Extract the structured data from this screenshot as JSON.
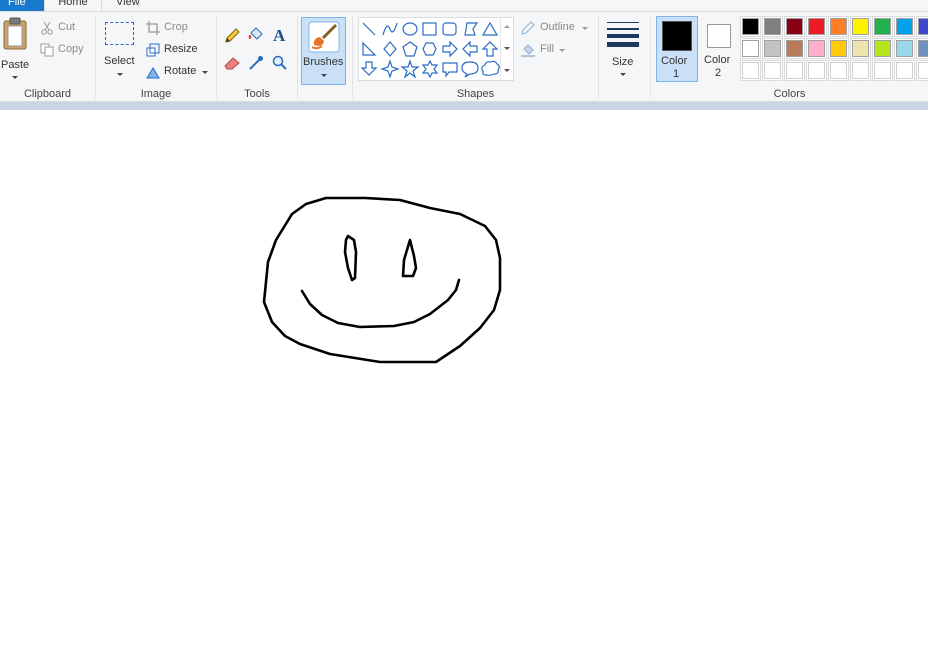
{
  "tabs": {
    "file": "File",
    "home": "Home",
    "view": "View"
  },
  "clipboard": {
    "paste": "Paste",
    "cut": "Cut",
    "copy": "Copy",
    "group": "Clipboard"
  },
  "image": {
    "select": "Select",
    "crop": "Crop",
    "resize": "Resize",
    "rotate": "Rotate",
    "group": "Image"
  },
  "tools": {
    "group": "Tools"
  },
  "brushes": {
    "label": "Brushes"
  },
  "shapes": {
    "outline": "Outline",
    "fill": "Fill",
    "group": "Shapes"
  },
  "size": {
    "label": "Size"
  },
  "colors": {
    "color1_line1": "Color",
    "color1_line2": "1",
    "color2_line1": "Color",
    "color2_line2": "2",
    "group": "Colors",
    "color1_value": "#000000",
    "color2_value": "#ffffff",
    "palette_row1": [
      "#000000",
      "#7f7f7f",
      "#880015",
      "#ed1c24",
      "#ff7f27",
      "#fff200",
      "#22b14c",
      "#00a2e8",
      "#3f48cc"
    ],
    "palette_row2": [
      "#ffffff",
      "#c3c3c3",
      "#b97a57",
      "#ffaec9",
      "#ffc90e",
      "#efe4b0",
      "#b5e61d",
      "#99d9ea",
      "#7092be"
    ],
    "palette_row3": [
      "#ffffff",
      "#ffffff",
      "#ffffff",
      "#ffffff",
      "#ffffff",
      "#ffffff",
      "#ffffff",
      "#ffffff",
      "#ffffff"
    ]
  }
}
